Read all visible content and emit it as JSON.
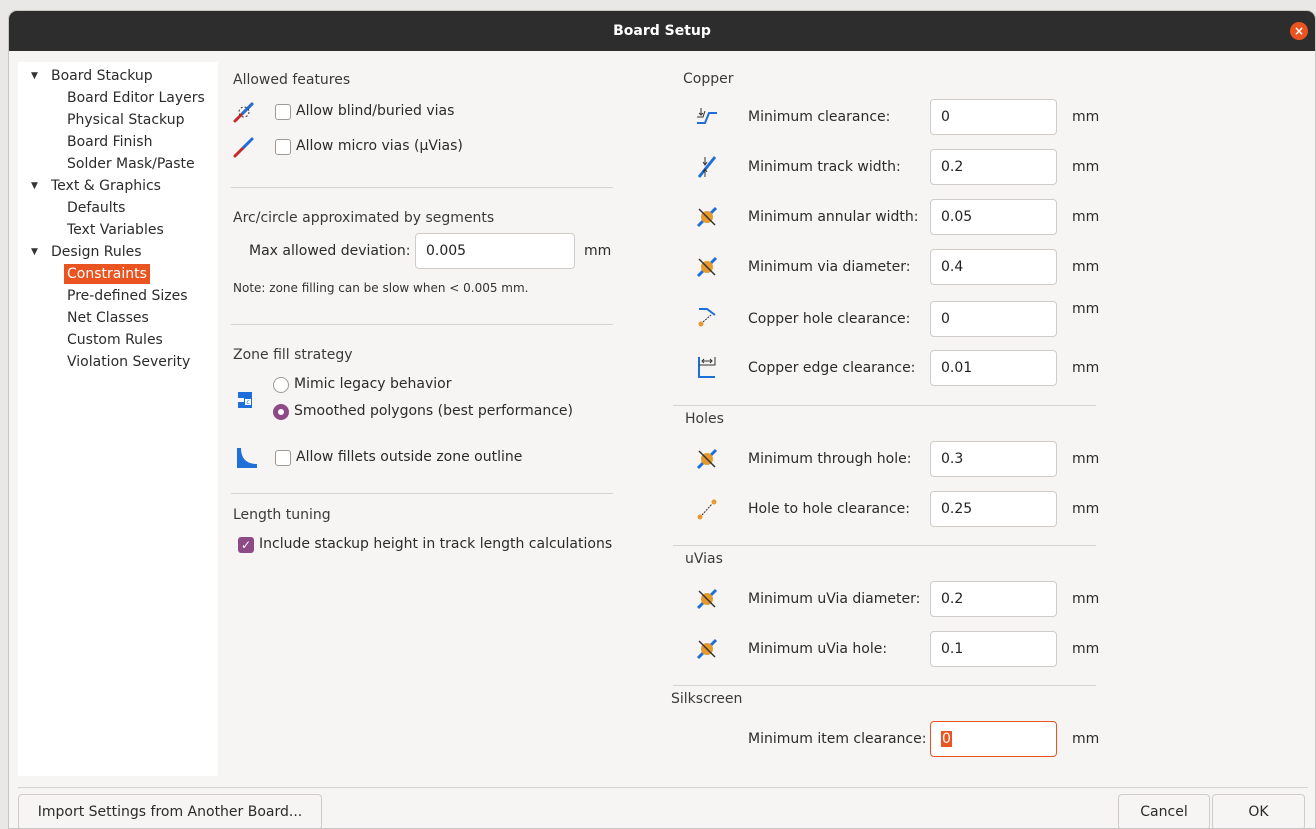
{
  "window": {
    "title": "Board Setup",
    "close_glyph": "×"
  },
  "tree": {
    "board_stackup": "Board Stackup",
    "board_editor_layers": "Board Editor Layers",
    "physical_stackup": "Physical Stackup",
    "board_finish": "Board Finish",
    "solder_mask_paste": "Solder Mask/Paste",
    "text_graphics": "Text & Graphics",
    "defaults": "Defaults",
    "text_variables": "Text Variables",
    "design_rules": "Design Rules",
    "constraints": "Constraints",
    "predefined_sizes": "Pre-defined Sizes",
    "net_classes": "Net Classes",
    "custom_rules": "Custom Rules",
    "violation_severity": "Violation Severity"
  },
  "allowed": {
    "title": "Allowed features",
    "blind_vias": "Allow blind/buried vias",
    "blind_vias_checked": false,
    "micro_vias": "Allow micro vias (μVias)",
    "micro_vias_checked": false
  },
  "arc": {
    "title": "Arc/circle approximated by segments",
    "label": "Max allowed deviation:",
    "value": "0.005",
    "unit": "mm",
    "note": "Note: zone filling can be slow when < 0.005 mm."
  },
  "zone": {
    "title": "Zone fill strategy",
    "legacy": "Mimic legacy behavior",
    "smoothed": "Smoothed polygons (best performance)",
    "selected": "smoothed",
    "fillets": "Allow fillets outside zone outline",
    "fillets_checked": false
  },
  "length": {
    "title": "Length tuning",
    "stackup": "Include stackup height in track length calculations",
    "stackup_checked": true
  },
  "copper": {
    "title": "Copper",
    "rows": [
      {
        "label": "Minimum clearance:",
        "value": "0",
        "unit": "mm",
        "icon": "clearance-icon"
      },
      {
        "label": "Minimum track width:",
        "value": "0.2",
        "unit": "mm",
        "icon": "track-width-icon"
      },
      {
        "label": "Minimum annular width:",
        "value": "0.05",
        "unit": "mm",
        "icon": "annular-width-icon"
      },
      {
        "label": "Minimum via diameter:",
        "value": "0.4",
        "unit": "mm",
        "icon": "via-diameter-icon"
      },
      {
        "label": "Copper hole clearance:",
        "value": "0",
        "unit": "mm",
        "icon": "hole-clearance-icon"
      },
      {
        "label": "Copper edge clearance:",
        "value": "0.01",
        "unit": "mm",
        "icon": "edge-clearance-icon"
      }
    ]
  },
  "holes": {
    "title": "Holes",
    "rows": [
      {
        "label": "Minimum through hole:",
        "value": "0.3",
        "unit": "mm",
        "icon": "through-hole-icon"
      },
      {
        "label": "Hole to hole clearance:",
        "value": "0.25",
        "unit": "mm",
        "icon": "hole-to-hole-icon"
      }
    ]
  },
  "uvias": {
    "title": "uVias",
    "rows": [
      {
        "label": "Minimum uVia diameter:",
        "value": "0.2",
        "unit": "mm",
        "icon": "uvia-diameter-icon"
      },
      {
        "label": "Minimum uVia hole:",
        "value": "0.1",
        "unit": "mm",
        "icon": "uvia-hole-icon"
      }
    ]
  },
  "silkscreen": {
    "title": "Silkscreen",
    "rows": [
      {
        "label": "Minimum item clearance:",
        "value": "0",
        "unit": "mm"
      }
    ]
  },
  "footer": {
    "import": "Import Settings from Another Board...",
    "cancel": "Cancel",
    "ok": "OK"
  },
  "colors": {
    "accent": "#e95420",
    "check": "#8e4a86",
    "titlebar": "#2d2d2d"
  }
}
